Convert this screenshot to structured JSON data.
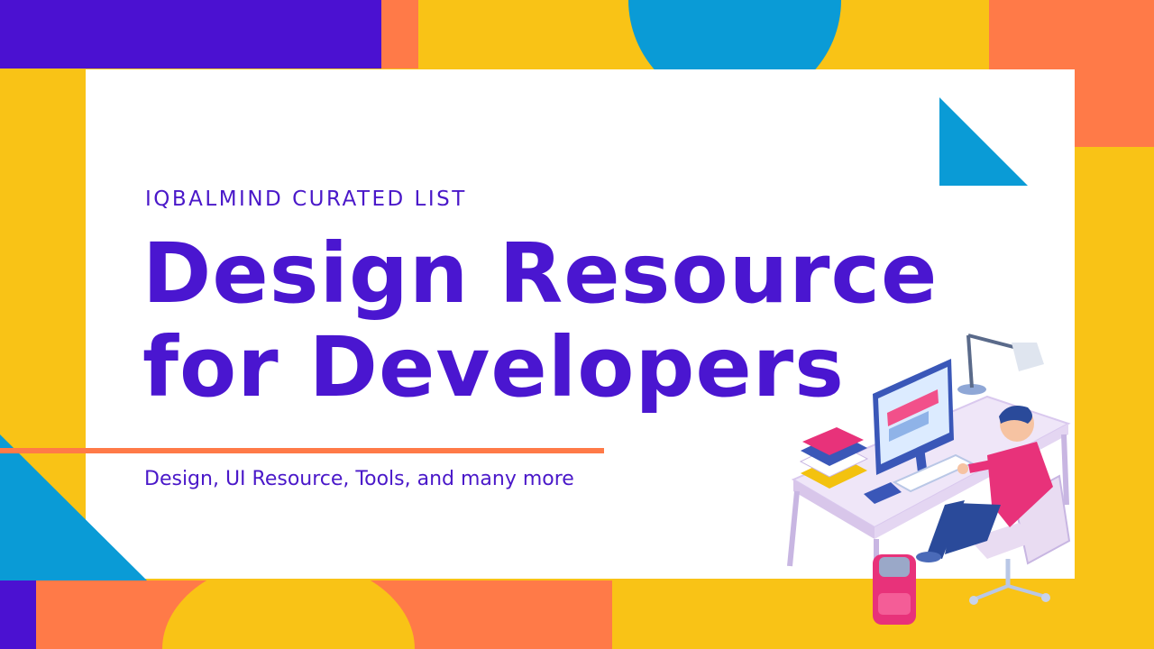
{
  "banner": {
    "overline": "IQBALMIND CURATED LIST",
    "title_line1": "Design Resource",
    "title_line2": "for Developers",
    "subtitle": "Design, UI Resource, Tools, and many more"
  },
  "colors": {
    "purple": "#4b11d1",
    "orange": "#ff7a48",
    "yellow": "#f9c316",
    "blue": "#0a9bd6",
    "white": "#ffffff",
    "text_purple": "#4a16d0"
  },
  "illustration": {
    "icon": "developer-at-desk-icon"
  }
}
